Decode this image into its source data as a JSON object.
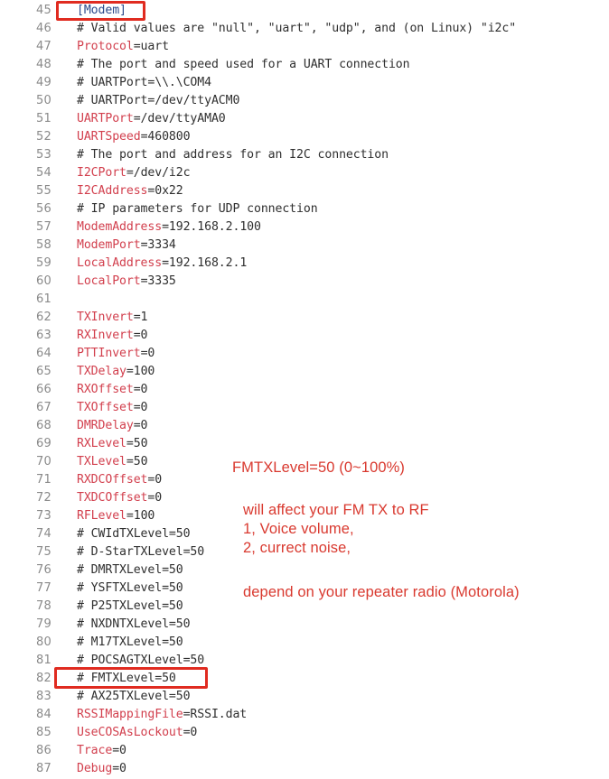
{
  "document": {
    "kind": "ini-config-editor",
    "first_line_number": 45,
    "colors": {
      "key": "#d23f4d",
      "value": "#2f2f2f",
      "comment": "#2f2f2f",
      "section": "#2b4a8b",
      "line_number": "#8a8a8a",
      "highlight_box": "#e02b20",
      "annotation": "#d9392f",
      "background": "#ffffff"
    }
  },
  "lines": [
    {
      "n": "45",
      "type": "section",
      "text": "[Modem]"
    },
    {
      "n": "46",
      "type": "comment",
      "text": "# Valid values are \"null\", \"uart\", \"udp\", and (on Linux) \"i2c\""
    },
    {
      "n": "47",
      "type": "pair",
      "key": "Protocol",
      "value": "=uart"
    },
    {
      "n": "48",
      "type": "comment",
      "text": "# The port and speed used for a UART connection"
    },
    {
      "n": "49",
      "type": "comment",
      "text": "# UARTPort=\\\\.\\COM4"
    },
    {
      "n": "50",
      "type": "comment",
      "text": "# UARTPort=/dev/ttyACM0"
    },
    {
      "n": "51",
      "type": "pair",
      "key": "UARTPort",
      "value": "=/dev/ttyAMA0"
    },
    {
      "n": "52",
      "type": "pair",
      "key": "UARTSpeed",
      "value": "=460800"
    },
    {
      "n": "53",
      "type": "comment",
      "text": "# The port and address for an I2C connection"
    },
    {
      "n": "54",
      "type": "pair",
      "key": "I2CPort",
      "value": "=/dev/i2c"
    },
    {
      "n": "55",
      "type": "pair",
      "key": "I2CAddress",
      "value": "=0x22"
    },
    {
      "n": "56",
      "type": "comment",
      "text": "# IP parameters for UDP connection"
    },
    {
      "n": "57",
      "type": "pair",
      "key": "ModemAddress",
      "value": "=192.168.2.100"
    },
    {
      "n": "58",
      "type": "pair",
      "key": "ModemPort",
      "value": "=3334"
    },
    {
      "n": "59",
      "type": "pair",
      "key": "LocalAddress",
      "value": "=192.168.2.1"
    },
    {
      "n": "60",
      "type": "pair",
      "key": "LocalPort",
      "value": "=3335"
    },
    {
      "n": "61",
      "type": "blank",
      "text": ""
    },
    {
      "n": "62",
      "type": "pair",
      "key": "TXInvert",
      "value": "=1"
    },
    {
      "n": "63",
      "type": "pair",
      "key": "RXInvert",
      "value": "=0"
    },
    {
      "n": "64",
      "type": "pair",
      "key": "PTTInvert",
      "value": "=0"
    },
    {
      "n": "65",
      "type": "pair",
      "key": "TXDelay",
      "value": "=100"
    },
    {
      "n": "66",
      "type": "pair",
      "key": "RXOffset",
      "value": "=0"
    },
    {
      "n": "67",
      "type": "pair",
      "key": "TXOffset",
      "value": "=0"
    },
    {
      "n": "68",
      "type": "pair",
      "key": "DMRDelay",
      "value": "=0"
    },
    {
      "n": "69",
      "type": "pair",
      "key": "RXLevel",
      "value": "=50"
    },
    {
      "n": "70",
      "type": "pair",
      "key": "TXLevel",
      "value": "=50"
    },
    {
      "n": "71",
      "type": "pair",
      "key": "RXDCOffset",
      "value": "=0"
    },
    {
      "n": "72",
      "type": "pair",
      "key": "TXDCOffset",
      "value": "=0"
    },
    {
      "n": "73",
      "type": "pair",
      "key": "RFLevel",
      "value": "=100"
    },
    {
      "n": "74",
      "type": "comment",
      "text": "# CWIdTXLevel=50"
    },
    {
      "n": "75",
      "type": "comment",
      "text": "# D-StarTXLevel=50"
    },
    {
      "n": "76",
      "type": "comment",
      "text": "# DMRTXLevel=50"
    },
    {
      "n": "77",
      "type": "comment",
      "text": "# YSFTXLevel=50"
    },
    {
      "n": "78",
      "type": "comment",
      "text": "# P25TXLevel=50"
    },
    {
      "n": "79",
      "type": "comment",
      "text": "# NXDNTXLevel=50"
    },
    {
      "n": "80",
      "type": "comment",
      "text": "# M17TXLevel=50"
    },
    {
      "n": "81",
      "type": "comment",
      "text": "# POCSAGTXLevel=50"
    },
    {
      "n": "82",
      "type": "comment",
      "text": "# FMTXLevel=50"
    },
    {
      "n": "83",
      "type": "comment",
      "text": "# AX25TXLevel=50"
    },
    {
      "n": "84",
      "type": "pair",
      "key": "RSSIMappingFile",
      "value": "=RSSI.dat"
    },
    {
      "n": "85",
      "type": "pair",
      "key": "UseCOSAsLockout",
      "value": "=0"
    },
    {
      "n": "86",
      "type": "pair",
      "key": "Trace",
      "value": "=0"
    },
    {
      "n": "87",
      "type": "pair",
      "key": "Debug",
      "value": "=0"
    }
  ],
  "highlights": [
    {
      "id": "hl-modem",
      "target_line": "45",
      "target_text": "[Modem]"
    },
    {
      "id": "hl-fmtxlevel",
      "target_line": "82",
      "target_text": "# FMTXLevel=50"
    }
  ],
  "annotations": {
    "title": "FMTXLevel=50 (0~100%)",
    "body": "will affect your FM TX to RF\n1, Voice volume,\n2, currect noise,",
    "footer": "depend on your repeater radio (Motorola)"
  }
}
